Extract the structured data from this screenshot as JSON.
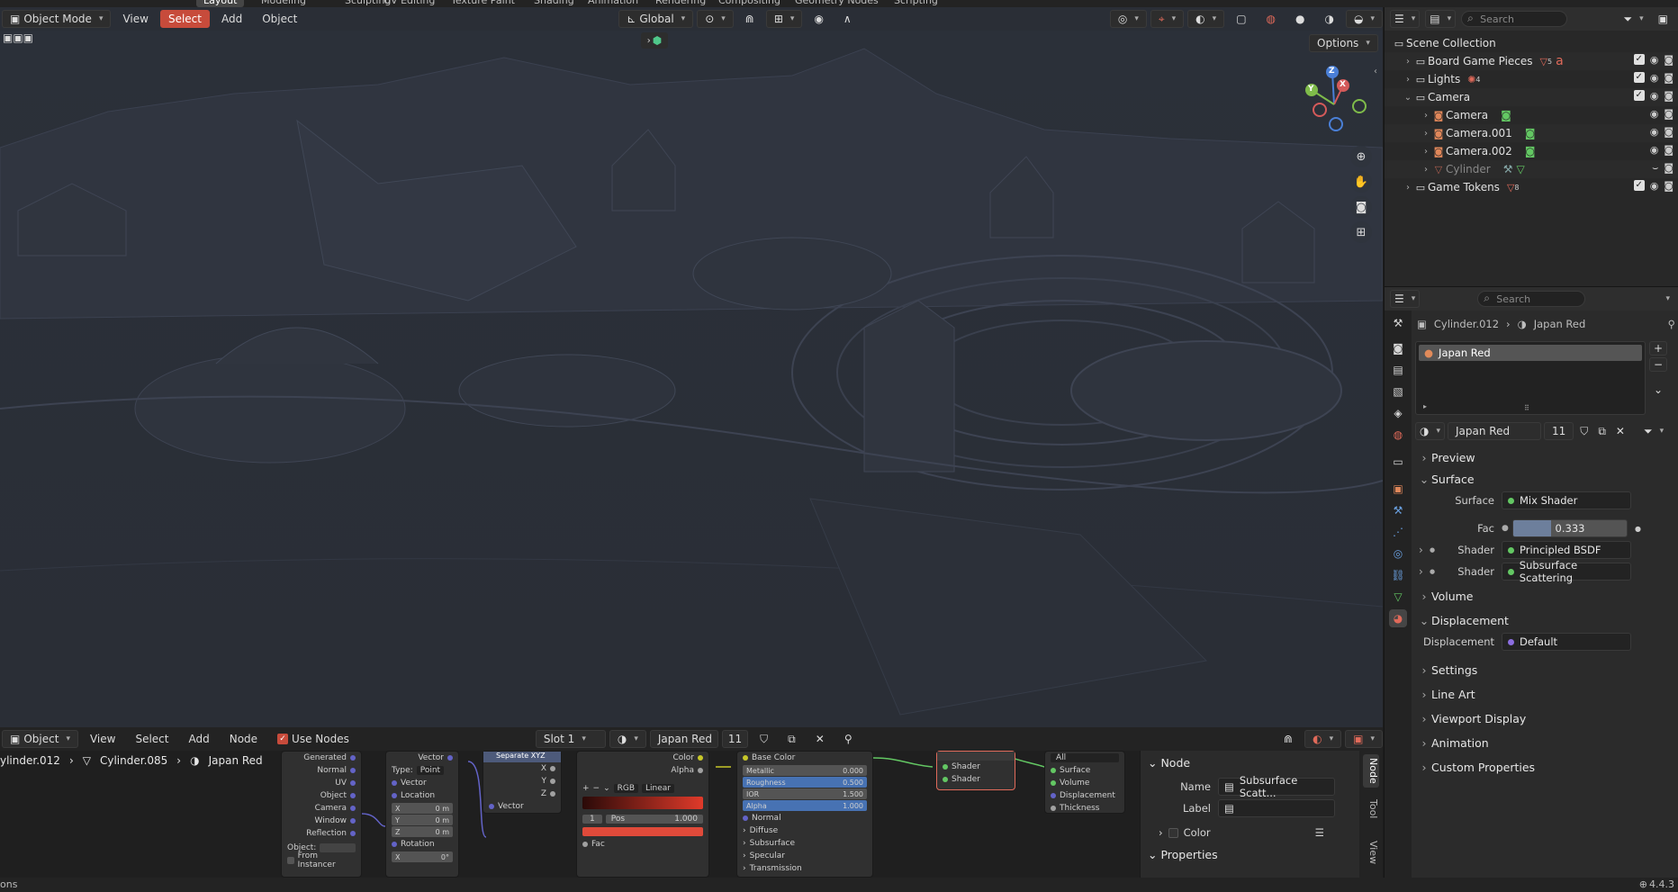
{
  "workspace_tabs": [
    "Layout",
    "Modeling",
    "Sculpting",
    "UV Editing",
    "Texture Paint",
    "Shading",
    "Animation",
    "Rendering",
    "Compositing",
    "Geometry Nodes",
    "Scripting"
  ],
  "viewport": {
    "mode": "Object Mode",
    "menus": [
      "View",
      "Select",
      "Add",
      "Object"
    ],
    "orientation": "Global",
    "options_label": "Options",
    "gizmo": {
      "z": "Z",
      "x": "X",
      "y": "Y"
    }
  },
  "outliner": {
    "search_placeholder": "Search",
    "rows": [
      {
        "label": "Scene Collection"
      },
      {
        "label": "Board Game Pieces",
        "badge": "5"
      },
      {
        "label": "Lights",
        "badge": "4"
      },
      {
        "label": "Camera"
      },
      {
        "label": "Camera"
      },
      {
        "label": "Camera.001"
      },
      {
        "label": "Camera.002"
      },
      {
        "label": "Cylinder"
      },
      {
        "label": "Game Tokens",
        "badge": "8"
      }
    ]
  },
  "properties": {
    "search_placeholder": "Search",
    "breadcrumb": {
      "object": "Cylinder.012",
      "material": "Japan Red"
    },
    "material_slot": "Japan Red",
    "material_name": "Japan Red",
    "material_users": "11",
    "sections": {
      "preview": "Preview",
      "surface": "Surface",
      "volume": "Volume",
      "displacement": "Displacement",
      "settings": "Settings",
      "line_art": "Line Art",
      "viewport_display": "Viewport Display",
      "animation": "Animation",
      "custom_properties": "Custom Properties"
    },
    "surface": {
      "surface_label": "Surface",
      "surface_value": "Mix Shader",
      "fac_label": "Fac",
      "fac_value": "0.333",
      "fac_fraction": 0.333,
      "shader1_label": "Shader",
      "shader1_value": "Principled BSDF",
      "shader2_label": "Shader",
      "shader2_value": "Subsurface Scattering"
    },
    "displacement": {
      "label": "Displacement",
      "value": "Default"
    }
  },
  "node_editor": {
    "type": "Object",
    "menus": [
      "View",
      "Select",
      "Add",
      "Node"
    ],
    "use_nodes_label": "Use Nodes",
    "slot": "Slot 1",
    "material": "Japan Red",
    "users": "11",
    "breadcrumb": [
      "ylinder.012",
      "Cylinder.085",
      "Japan Red"
    ],
    "texcoord_outputs": [
      "Generated",
      "Normal",
      "UV",
      "Object",
      "Camera",
      "Window",
      "Reflection"
    ],
    "texcoord_object_label": "Object:",
    "texcoord_from_instancer": "From Instancer",
    "mapping": {
      "vector": "Vector",
      "type_label": "Type:",
      "type_value": "Point",
      "vector_in": "Vector",
      "location": "Location",
      "rotation": "Rotation",
      "x": "X",
      "y": "Y",
      "z": "Z",
      "x_val": "0 m",
      "y_val": "0 m",
      "z_val": "0 m",
      "rx_val": "0°"
    },
    "separate": {
      "title": "Separate XYZ",
      "x": "X",
      "y": "Y",
      "z": "Z",
      "vector": "Vector"
    },
    "ramp": {
      "color": "Color",
      "alpha": "Alpha",
      "mode": "RGB",
      "interp": "Linear",
      "index": "1",
      "pos_label": "Pos",
      "pos_value": "1.000",
      "fac": "Fac"
    },
    "bsdf": {
      "base_color": "Base Color",
      "metallic": "Metallic",
      "metallic_val": "0.000",
      "roughness": "Roughness",
      "roughness_val": "0.500",
      "ior": "IOR",
      "ior_val": "1.500",
      "alpha": "Alpha",
      "alpha_val": "1.000",
      "normal": "Normal",
      "diffuse": "Diffuse",
      "subsurface": "Subsurface",
      "specular": "Specular",
      "transmission": "Transmission"
    },
    "mix": {
      "shader1": "Shader",
      "shader2": "Shader"
    },
    "output": {
      "target": "All",
      "surface": "Surface",
      "volume": "Volume",
      "displacement": "Displacement",
      "thickness": "Thickness"
    },
    "sidebar": {
      "section_node": "Node",
      "name_label": "Name",
      "name_value": "Subsurface Scatt...",
      "label_label": "Label",
      "color_label": "Color",
      "properties_label": "Properties",
      "tabs": [
        "Node",
        "Tool",
        "View"
      ]
    }
  },
  "status": {
    "left": "ons",
    "version": "4.4.3"
  }
}
